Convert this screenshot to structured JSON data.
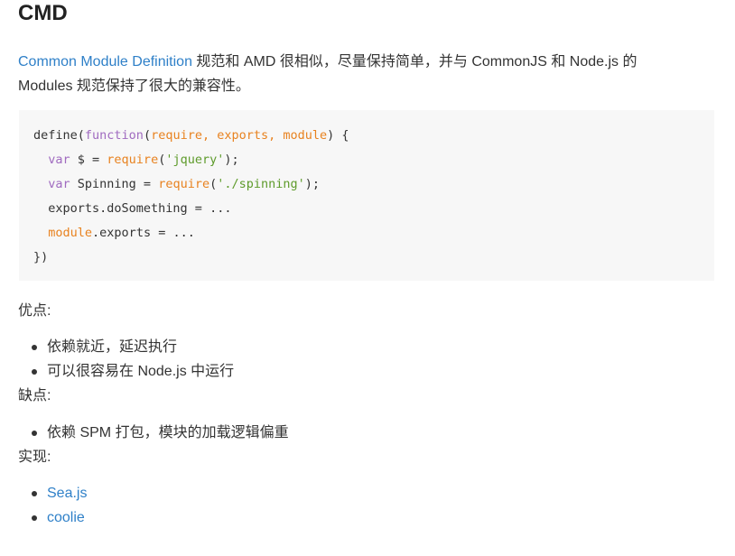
{
  "heading": "CMD",
  "intro": {
    "link_text": "Common Module Definition",
    "text": " 规范和 AMD 很相似，尽量保持简单，并与 CommonJS 和 Node.js 的 Modules 规范保持了很大的兼容性。"
  },
  "code": {
    "l1": {
      "a": "define(",
      "b": "function",
      "c": "(",
      "d": "require, exports, module",
      "e": ") {"
    },
    "l2": {
      "a": "  ",
      "b": "var",
      "c": " $ = ",
      "d": "require",
      "e": "(",
      "f": "'jquery'",
      "g": ");"
    },
    "l3": {
      "a": "  ",
      "b": "var",
      "c": " Spinning = ",
      "d": "require",
      "e": "(",
      "f": "'./spinning'",
      "g": ");"
    },
    "l4": {
      "a": "  exports.doSomething = ..."
    },
    "l5": {
      "a": "  ",
      "b": "module",
      "c": ".exports = ..."
    },
    "l6": {
      "a": "})"
    }
  },
  "pros": {
    "label": "优点:",
    "items": [
      "依赖就近，延迟执行",
      "可以很容易在 Node.js 中运行"
    ]
  },
  "cons": {
    "label": "缺点:",
    "items": [
      "依赖 SPM 打包，模块的加载逻辑偏重"
    ]
  },
  "impl": {
    "label": "实现:",
    "items": [
      "Sea.js",
      "coolie"
    ]
  },
  "colors": {
    "link": "#2f80c8",
    "keyword": "#a06bc0",
    "param": "#e8821f",
    "string": "#5e9b2b",
    "code_bg": "#f7f7f7"
  }
}
